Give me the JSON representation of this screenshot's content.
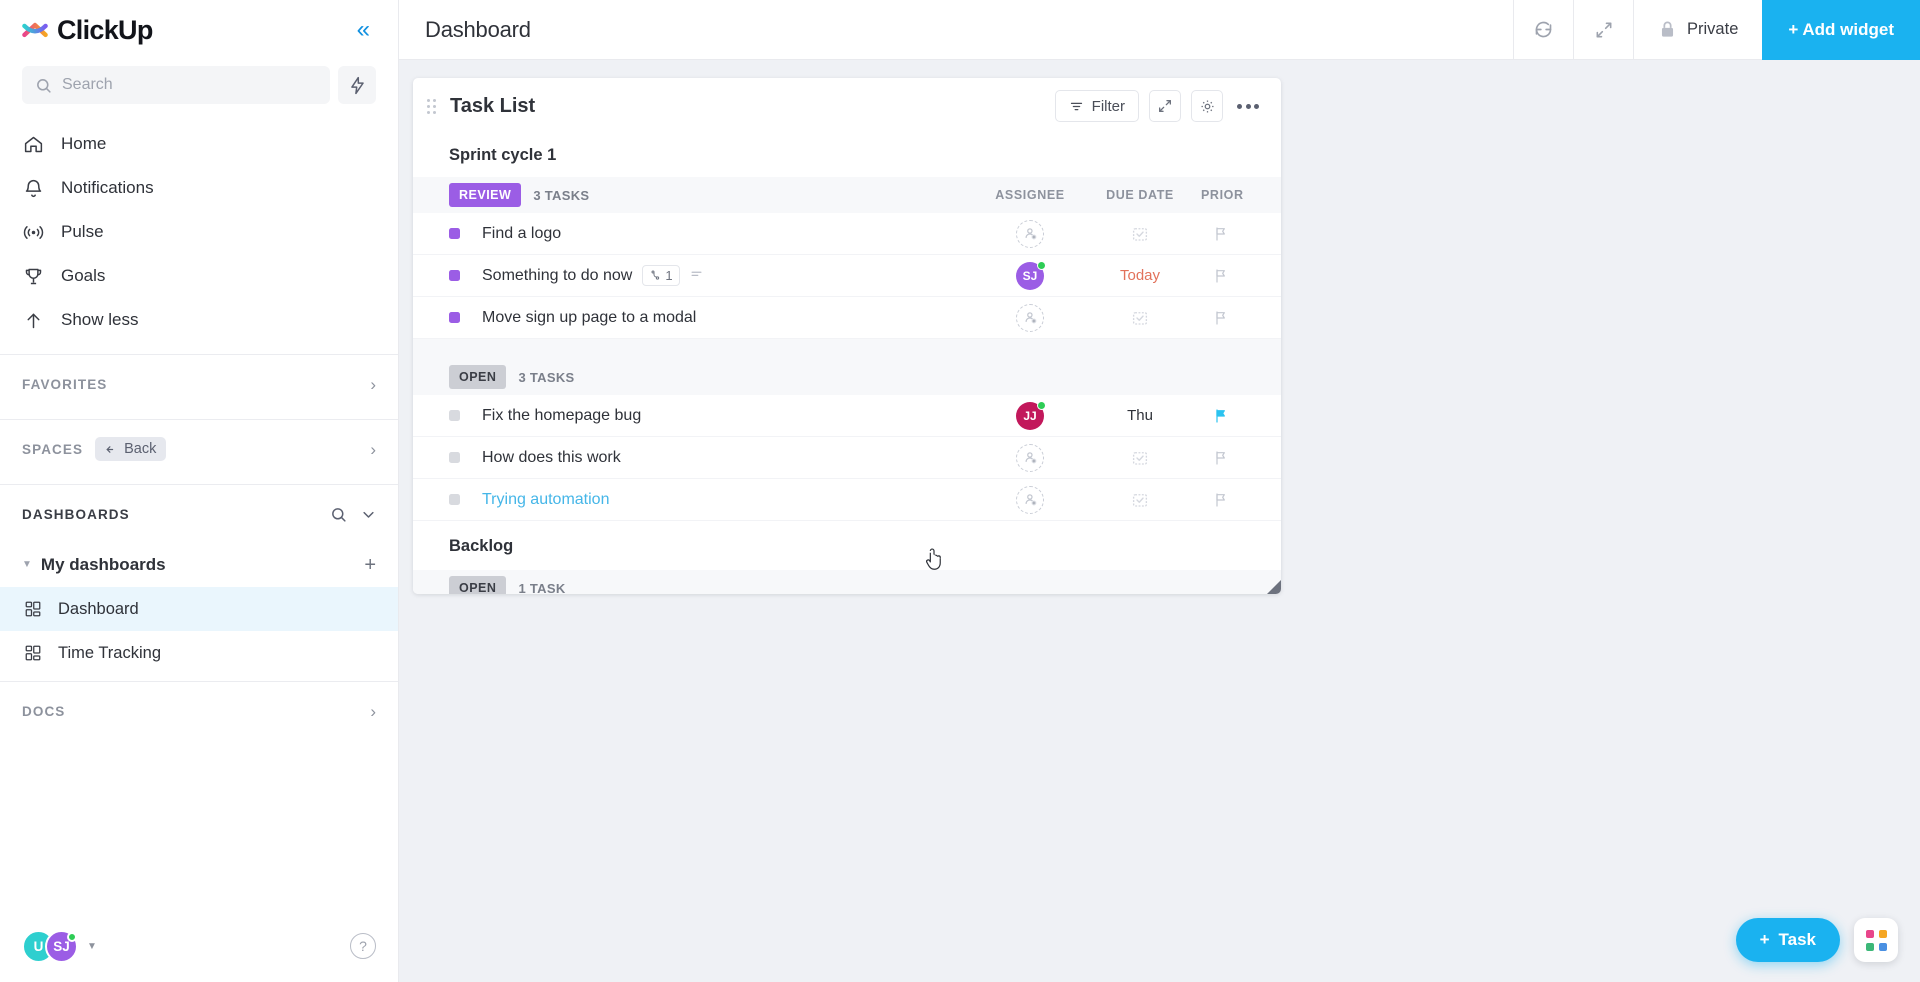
{
  "sidebar": {
    "brand": "ClickUp",
    "collapse_icon": "double-chevron-left-icon",
    "search": {
      "placeholder": "Search",
      "icon": "search-icon"
    },
    "bolt_icon": "lightning-bolt-icon",
    "nav": [
      {
        "label": "Home",
        "icon": "home-icon"
      },
      {
        "label": "Notifications",
        "icon": "bell-icon"
      },
      {
        "label": "Pulse",
        "icon": "pulse-icon"
      },
      {
        "label": "Goals",
        "icon": "trophy-icon"
      },
      {
        "label": "Show less",
        "icon": "arrow-up-icon"
      }
    ],
    "sections": [
      {
        "label": "FAVORITES",
        "chevron": "chevron-right-icon"
      },
      {
        "label": "SPACES",
        "chip": "Back",
        "chip_icon": "back-arrow-icon",
        "chevron": "chevron-right-icon"
      }
    ],
    "dashboards": {
      "label": "DASHBOARDS",
      "search_icon": "search-icon",
      "chevron_icon": "chevron-down-icon",
      "group": {
        "label": "My dashboards",
        "add_icon": "plus-icon",
        "caret": "caret-down-icon"
      },
      "items": [
        {
          "label": "Dashboard",
          "icon": "dashboard-grid-icon",
          "active": true
        },
        {
          "label": "Time Tracking",
          "icon": "dashboard-grid-icon",
          "active": false
        }
      ]
    },
    "docs": {
      "label": "DOCS",
      "chevron": "chevron-right-icon"
    },
    "footer": {
      "avatars": [
        {
          "initials": "U",
          "color": "#2ecfcf"
        },
        {
          "initials": "SJ",
          "color": "#9b5de5",
          "online": true
        }
      ],
      "caret": "caret-down-icon",
      "help_label": "?"
    }
  },
  "topbar": {
    "title": "Dashboard",
    "refresh_icon": "refresh-icon",
    "expand_icon": "expand-arrows-icon",
    "privacy": {
      "label": "Private",
      "icon": "lock-icon"
    },
    "add_widget_label": "+ Add widget"
  },
  "widget": {
    "title": "Task List",
    "drag_handle": "drag-dots-icon",
    "toolbar": {
      "filter_label": "Filter",
      "filter_icon": "filter-icon",
      "expand_icon": "expand-arrows-icon",
      "settings_icon": "gear-icon",
      "more_icon": "ellipsis-icon"
    },
    "sprint_title": "Sprint cycle 1",
    "backlog_title": "Backlog",
    "columns": {
      "assignee": "ASSIGNEE",
      "due": "DUE DATE",
      "priority": "PRIOR"
    },
    "groups": [
      {
        "status": "REVIEW",
        "status_color": "#9b5de5",
        "status_text_color": "#ffffff",
        "count": "3 TASKS",
        "tasks": [
          {
            "name": "Find a logo",
            "dot": "review",
            "assignee": null,
            "due": "",
            "due_style": "empty",
            "priority": "flag-outline-icon"
          },
          {
            "name": "Something to do now",
            "dot": "review",
            "subtask_count": "1",
            "subtask_icon": "link-icon",
            "extra_icon": "equals-icon",
            "assignee": {
              "initials": "SJ",
              "color": "#9b5de5",
              "online": true
            },
            "due": "Today",
            "due_style": "today",
            "priority": "flag-outline-icon"
          },
          {
            "name": "Move sign up page to a modal",
            "dot": "review",
            "assignee": null,
            "due": "",
            "due_style": "empty",
            "priority": "flag-outline-icon"
          }
        ]
      },
      {
        "status": "OPEN",
        "status_color": "#ccced4",
        "status_text_color": "#3a3d45",
        "count": "3 TASKS",
        "tasks": [
          {
            "name": "Fix the homepage bug",
            "dot": "open",
            "assignee": {
              "initials": "JJ",
              "color": "#c2185b",
              "online": true
            },
            "due": "Thu",
            "due_style": "normal",
            "priority": "flag-filled-icon",
            "priority_color": "#2bc3f0"
          },
          {
            "name": "How does this work",
            "dot": "open",
            "assignee": null,
            "due": "",
            "due_style": "empty",
            "priority": "flag-outline-icon"
          },
          {
            "name": "Trying automation",
            "dot": "open",
            "link_style": true,
            "assignee": null,
            "due": "",
            "due_style": "empty",
            "priority": "flag-outline-icon"
          }
        ]
      }
    ],
    "backlog_group": {
      "status": "OPEN",
      "count": "1 TASK"
    }
  },
  "fab": {
    "task_label": "Task",
    "task_plus": "+",
    "apps_icon": "apps-grid-icon",
    "apps_colors": [
      "#e8458b",
      "#f5a623",
      "#3cb878",
      "#4a90e2"
    ]
  }
}
